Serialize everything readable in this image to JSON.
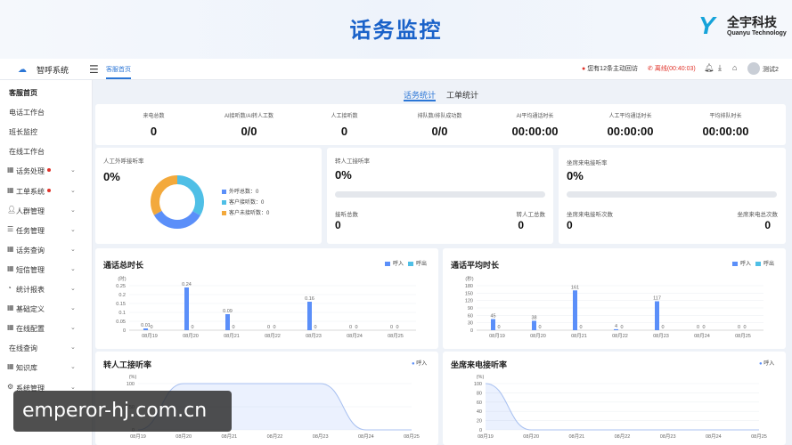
{
  "banner": {
    "title": "话务监控",
    "brand_cn": "全宇科技",
    "brand_en": "Quanyu Technology"
  },
  "topbar": {
    "app_name": "智呼系统",
    "tab_home": "客服首页",
    "notice": "您有12条主动回访",
    "call_status": "离线(00:40:03)",
    "user": "测试2"
  },
  "sidebar": {
    "items": [
      {
        "label": "客服首页",
        "active": true
      },
      {
        "label": "电话工作台"
      },
      {
        "label": "班长监控"
      },
      {
        "label": "在线工作台"
      },
      {
        "label": "话务处理",
        "dot": true,
        "arrow": true,
        "icon": "grid-icon"
      },
      {
        "label": "工单系统",
        "dot": true,
        "arrow": true,
        "icon": "grid-icon"
      },
      {
        "label": "人群管理",
        "arrow": true,
        "icon": "people-icon"
      },
      {
        "label": "任务管理",
        "arrow": true,
        "icon": "task-icon"
      },
      {
        "label": "话务查询",
        "arrow": true,
        "icon": "grid-icon"
      },
      {
        "label": "短信管理",
        "arrow": true,
        "icon": "grid-icon"
      },
      {
        "label": "统计报表",
        "arrow": true,
        "icon": "pie-icon"
      },
      {
        "label": "基础定义",
        "arrow": true,
        "icon": "grid-icon"
      },
      {
        "label": "在线配置",
        "arrow": true,
        "icon": "grid-icon"
      },
      {
        "label": "在线查询",
        "arrow": true
      },
      {
        "label": "知识库",
        "arrow": true,
        "icon": "grid-icon"
      },
      {
        "label": "系统管理",
        "arrow": true,
        "icon": "gear-icon"
      }
    ]
  },
  "subtabs": {
    "tab1": "话务统计",
    "tab2": "工单统计"
  },
  "kpis": [
    {
      "label": "来电总数",
      "value": "0"
    },
    {
      "label": "AI接听数/AI转人工数",
      "value": "0/0"
    },
    {
      "label": "人工接听数",
      "value": "0"
    },
    {
      "label": "排队数/排队成功数",
      "value": "0/0"
    },
    {
      "label": "AI平均通话时长",
      "value": "00:00:00"
    },
    {
      "label": "人工平均通话时长",
      "value": "00:00:00"
    },
    {
      "label": "平均排队时长",
      "value": "00:00:00"
    }
  ],
  "card_outbound": {
    "title": "人工外呼接听率",
    "rate": "0%",
    "legend": [
      {
        "label": "外呼总数：0",
        "color": "#5b8ff9"
      },
      {
        "label": "客户接听数：0",
        "color": "#4fbfe6"
      },
      {
        "label": "客户未接听数：0",
        "color": "#f3a93c"
      }
    ]
  },
  "card_transfer": {
    "title": "转人工接听率",
    "rate": "0%",
    "left_label": "接听总数",
    "left_value": "0",
    "right_label": "转人工总数",
    "right_value": "0"
  },
  "card_seat": {
    "title": "坐席来电接听率",
    "rate": "0%",
    "left_label": "坐席来电接听次数",
    "left_value": "0",
    "right_label": "坐席来电总次数",
    "right_value": "0"
  },
  "chart_titles": {
    "total_duration": "通话总时长",
    "avg_duration": "通话平均时长",
    "transfer_rate": "转人工接听率",
    "seat_rate": "坐席来电接听率"
  },
  "legend": {
    "in": "呼入",
    "out": "呼出"
  },
  "colors": {
    "accent": "#2b76d6",
    "in": "#5b8ff9",
    "out": "#4fbfe6",
    "warn": "#e0342b"
  },
  "chart_data": [
    {
      "type": "bar",
      "title": "通话总时长",
      "ylabel": "(时)",
      "categories": [
        "08月19",
        "08月20",
        "08月21",
        "08月22",
        "08月23",
        "08月24",
        "08月25"
      ],
      "ylim": [
        0,
        0.25
      ],
      "yticks": [
        "0",
        "0.05",
        "0.1",
        "0.15",
        "0.2",
        "0.25"
      ],
      "series": [
        {
          "name": "呼入",
          "values": [
            0.01,
            0.24,
            0.09,
            0,
            0.16,
            0,
            0
          ]
        },
        {
          "name": "呼出",
          "values": [
            0,
            0,
            0,
            0,
            0,
            0,
            0
          ]
        }
      ],
      "labels_in": [
        "0.01",
        "0.24",
        "0.09",
        "0",
        "0.16",
        "0",
        "0"
      ],
      "labels_out": [
        "0",
        "0",
        "0",
        "0",
        "0",
        "0",
        "0"
      ]
    },
    {
      "type": "bar",
      "title": "通话平均时长",
      "ylabel": "(秒)",
      "categories": [
        "08月19",
        "08月20",
        "08月21",
        "08月22",
        "08月23",
        "08月24",
        "08月25"
      ],
      "ylim": [
        0,
        180
      ],
      "yticks": [
        "0",
        "30",
        "60",
        "90",
        "120",
        "150",
        "180"
      ],
      "series": [
        {
          "name": "呼入",
          "values": [
            45,
            38,
            161,
            4,
            117,
            0,
            0
          ]
        },
        {
          "name": "呼出",
          "values": [
            0,
            0,
            0,
            0,
            0,
            0,
            0
          ]
        }
      ],
      "labels_in": [
        "45",
        "38",
        "161",
        "4",
        "117",
        "0",
        "0"
      ],
      "labels_out": [
        "0",
        "0",
        "0",
        "0",
        "0",
        "0",
        "0"
      ]
    },
    {
      "type": "area",
      "title": "转人工接听率",
      "ylabel": "(%)",
      "categories": [
        "08月19",
        "08月20",
        "08月21",
        "08月22",
        "08月23",
        "08月24",
        "08月25"
      ],
      "ylim": [
        0,
        100
      ],
      "yticks": [
        "0",
        "50",
        "100"
      ],
      "series": [
        {
          "name": "呼入",
          "values": [
            0,
            100,
            100,
            100,
            100,
            0,
            0
          ]
        }
      ]
    },
    {
      "type": "area",
      "title": "坐席来电接听率",
      "ylabel": "(%)",
      "categories": [
        "08月19",
        "08月20",
        "08月21",
        "08月22",
        "08月23",
        "08月24",
        "08月25"
      ],
      "ylim": [
        0,
        100
      ],
      "yticks": [
        "0",
        "20",
        "40",
        "60",
        "80",
        "100"
      ],
      "series": [
        {
          "name": "呼入",
          "values": [
            100,
            0,
            0,
            0,
            0,
            0,
            0
          ]
        }
      ]
    }
  ],
  "watermark": "emperor-hj.com.cn"
}
